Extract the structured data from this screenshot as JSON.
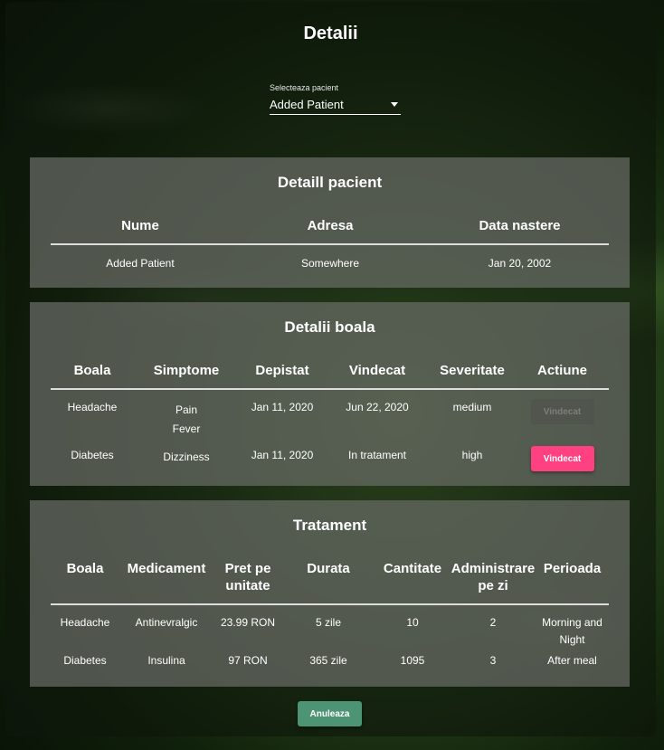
{
  "title": "Detalii",
  "patient_select": {
    "label": "Selecteaza pacient",
    "value": "Added Patient"
  },
  "patient_details": {
    "title": "Detaill pacient",
    "headers": [
      "Nume",
      "Adresa",
      "Data nastere"
    ],
    "row": [
      "Added Patient",
      "Somewhere",
      "Jan 20, 2002"
    ]
  },
  "disease_details": {
    "title": "Detalii boala",
    "headers": [
      "Boala",
      "Simptome",
      "Depistat",
      "Vindecat",
      "Severitate",
      "Actiune"
    ],
    "rows": [
      {
        "boala": "Headache",
        "simptome": [
          "Pain",
          "Fever"
        ],
        "depistat": "Jan 11, 2020",
        "vindecat": "Jun 22, 2020",
        "severitate": "medium",
        "actiune": "Vindecat",
        "enabled": false
      },
      {
        "boala": "Diabetes",
        "simptome": [
          "Dizziness"
        ],
        "depistat": "Jan 11, 2020",
        "vindecat": "In tratament",
        "severitate": "high",
        "actiune": "Vindecat",
        "enabled": true
      }
    ]
  },
  "treatment": {
    "title": "Tratament",
    "headers": [
      "Boala",
      "Medicament",
      "Pret pe unitate",
      "Durata",
      "Cantitate",
      "Administrare pe zi",
      "Perioada"
    ],
    "rows": [
      [
        "Headache",
        "Antinevralgic",
        "23.99 RON",
        "5 zile",
        "10",
        "2",
        "Morning and Night"
      ],
      [
        "Diabetes",
        "Insulina",
        "97 RON",
        "365 zile",
        "1095",
        "3",
        "After meal"
      ]
    ]
  },
  "cancel_label": "Anuleaza",
  "colors": {
    "accent_pink": "#ff4081",
    "cancel_green": "#4d9474"
  }
}
